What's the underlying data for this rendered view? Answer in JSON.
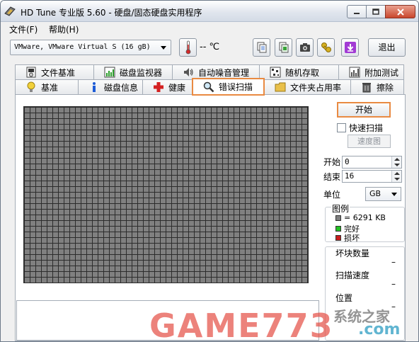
{
  "window": {
    "title": "HD Tune 专业版 5.60 - 硬盘/固态硬盘实用程序"
  },
  "menu": {
    "file": "文件(F)",
    "help": "帮助(H)"
  },
  "toolbar": {
    "drive": "VMware, VMware Virtual S (16 gB)",
    "temperature": "-- ℃",
    "exit": "退出"
  },
  "tabs_top": [
    {
      "label": "文件基准",
      "icon": "file-benchmark-icon"
    },
    {
      "label": "磁盘监视器",
      "icon": "monitor-chart-icon"
    },
    {
      "label": "自动噪音管理",
      "icon": "speaker-icon"
    },
    {
      "label": "随机存取",
      "icon": "random-access-icon"
    },
    {
      "label": "附加测试",
      "icon": "extra-tests-icon"
    }
  ],
  "tabs_bottom": [
    {
      "label": "基准",
      "icon": "lightbulb-icon"
    },
    {
      "label": "磁盘信息",
      "icon": "info-icon"
    },
    {
      "label": "健康",
      "icon": "red-cross-icon"
    },
    {
      "label": "错误扫描",
      "icon": "magnifier-icon",
      "active": true
    },
    {
      "label": "文件夹占用率",
      "icon": "folder-icon"
    },
    {
      "label": "擦除",
      "icon": "trash-icon"
    }
  ],
  "scan": {
    "start_button": "开始",
    "quick_scan": "快速扫描",
    "quick_scan_checked": false,
    "speed_map": "速度图",
    "start_label": "开始",
    "start_value": "0",
    "end_label": "结束",
    "end_value": "16",
    "unit_label": "单位",
    "unit_value": "GB"
  },
  "legend": {
    "title": "图例",
    "block": "= 6291 KB",
    "ok": "完好",
    "damaged": "损坏",
    "colors": {
      "block": "#808080",
      "ok": "#22c122",
      "damaged": "#c81e1e"
    }
  },
  "stats": {
    "bad_blocks_label": "坏块数量",
    "bad_blocks_value": "–",
    "scan_speed_label": "扫描速度",
    "scan_speed_value": "–",
    "position_label": "位置",
    "position_value": "–"
  },
  "watermark": {
    "logo": "GAME773",
    "site": "系统之家",
    "domain": ".com"
  }
}
